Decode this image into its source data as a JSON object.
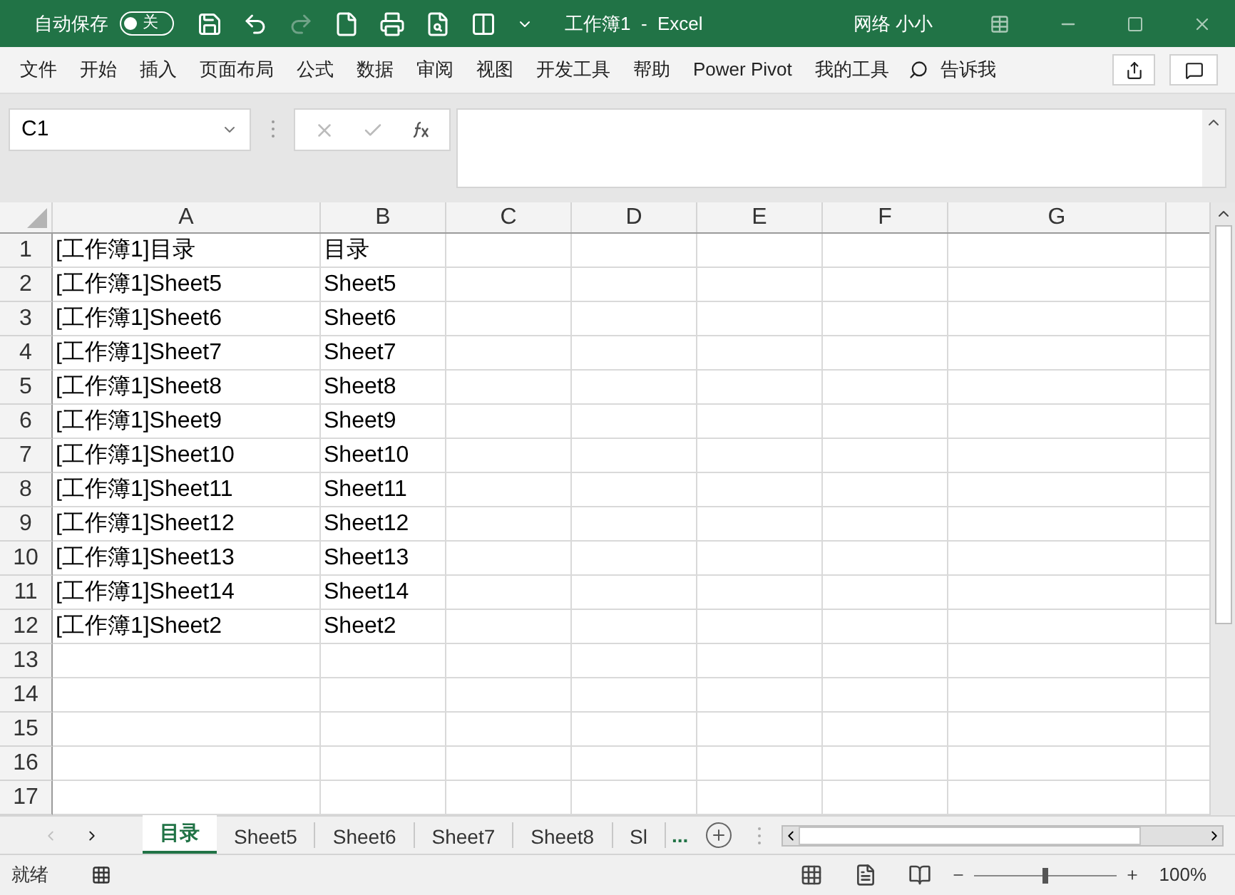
{
  "title_bar": {
    "autosave_label": "自动保存",
    "autosave_toggle": {
      "on": false,
      "label": "关"
    },
    "title": "工作簿1  -  Excel",
    "user": "网络 小小"
  },
  "menu": {
    "items": [
      "文件",
      "开始",
      "插入",
      "页面布局",
      "公式",
      "数据",
      "审阅",
      "视图",
      "开发工具",
      "帮助",
      "Power Pivot",
      "我的工具"
    ],
    "tell_me": "告诉我"
  },
  "name_box": "C1",
  "sheet": {
    "columns": [
      "A",
      "B",
      "C",
      "D",
      "E",
      "F",
      "G"
    ],
    "rows": [
      {
        "number": "1",
        "cells": [
          "[工作簿1]目录",
          "目录"
        ]
      },
      {
        "number": "2",
        "cells": [
          "[工作簿1]Sheet5",
          "Sheet5"
        ]
      },
      {
        "number": "3",
        "cells": [
          "[工作簿1]Sheet6",
          "Sheet6"
        ]
      },
      {
        "number": "4",
        "cells": [
          "[工作簿1]Sheet7",
          "Sheet7"
        ]
      },
      {
        "number": "5",
        "cells": [
          "[工作簿1]Sheet8",
          "Sheet8"
        ]
      },
      {
        "number": "6",
        "cells": [
          "[工作簿1]Sheet9",
          "Sheet9"
        ]
      },
      {
        "number": "7",
        "cells": [
          "[工作簿1]Sheet10",
          "Sheet10"
        ]
      },
      {
        "number": "8",
        "cells": [
          "[工作簿1]Sheet11",
          "Sheet11"
        ]
      },
      {
        "number": "9",
        "cells": [
          "[工作簿1]Sheet12",
          "Sheet12"
        ]
      },
      {
        "number": "10",
        "cells": [
          "[工作簿1]Sheet13",
          "Sheet13"
        ]
      },
      {
        "number": "11",
        "cells": [
          "[工作簿1]Sheet14",
          "Sheet14"
        ]
      },
      {
        "number": "12",
        "cells": [
          "[工作簿1]Sheet2",
          "Sheet2"
        ]
      },
      {
        "number": "13",
        "cells": []
      },
      {
        "number": "14",
        "cells": []
      },
      {
        "number": "15",
        "cells": []
      },
      {
        "number": "16",
        "cells": []
      },
      {
        "number": "17",
        "cells": []
      }
    ]
  },
  "sheet_tabs": [
    {
      "label": "目录",
      "selected": true
    },
    {
      "label": "Sheet5",
      "selected": false
    },
    {
      "label": "Sheet6",
      "selected": false
    },
    {
      "label": "Sheet7",
      "selected": false
    },
    {
      "label": "Sheet8",
      "selected": false
    },
    {
      "label": "Sl",
      "selected": false
    }
  ],
  "more_tabs": "...",
  "status_bar": {
    "status": "就绪",
    "zoom": {
      "level": 0.5,
      "reading": "100%"
    }
  }
}
